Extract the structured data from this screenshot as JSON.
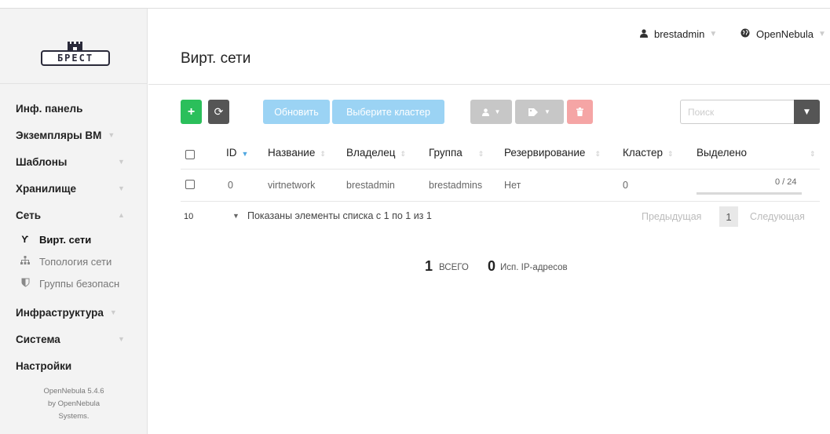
{
  "brand": {
    "logo_text": "БРЕСТ"
  },
  "sidebar": {
    "items": [
      {
        "label": "Инф. панель"
      },
      {
        "label": "Экземпляры ВМ"
      },
      {
        "label": "Шаблоны"
      },
      {
        "label": "Хранилище"
      },
      {
        "label": "Сеть"
      },
      {
        "label": "Инфраструктура"
      },
      {
        "label": "Система"
      },
      {
        "label": "Настройки"
      }
    ],
    "network_sub": [
      {
        "label": "Вирт. сети",
        "icon": "network-fork-icon"
      },
      {
        "label": "Топология сети",
        "icon": "sitemap-icon"
      },
      {
        "label": "Группы безопасн",
        "icon": "shield-icon"
      }
    ],
    "footer": {
      "line1": "OpenNebula 5.4.6",
      "line2": "by OpenNebula",
      "line3": "Systems."
    }
  },
  "header": {
    "title": "Вирт. сети",
    "user": "brestadmin",
    "zone": "OpenNebula"
  },
  "toolbar": {
    "add_label": "+",
    "refresh_icon": "refresh-icon",
    "update_label": "Обновить",
    "cluster_label": "Выберите кластер",
    "search_placeholder": "Поиск"
  },
  "table": {
    "columns": [
      "ID",
      "Название",
      "Владелец",
      "Группа",
      "Резервирование",
      "Кластер",
      "Выделено"
    ],
    "rows": [
      {
        "id": "0",
        "name": "virtnetwork",
        "owner": "brestadmin",
        "group": "brestadmins",
        "reservation": "Нет",
        "cluster": "0",
        "allocated": "0 / 24",
        "usage_fraction": 0
      }
    ]
  },
  "pagination": {
    "page_size": "10",
    "info": "Показаны элементы списка с 1 по 1 из 1",
    "prev": "Предыдущая",
    "current": "1",
    "next": "Следующая"
  },
  "stats": {
    "total_value": "1",
    "total_label": "ВСЕГО",
    "used_ips_value": "0",
    "used_ips_label": "Исп. IP-адресов"
  },
  "colors": {
    "add": "#2bbf5b",
    "primary_light": "#9bd3f4",
    "danger_light": "#f5a5a5",
    "dark": "#555555",
    "accent": "#4fa7e0"
  }
}
